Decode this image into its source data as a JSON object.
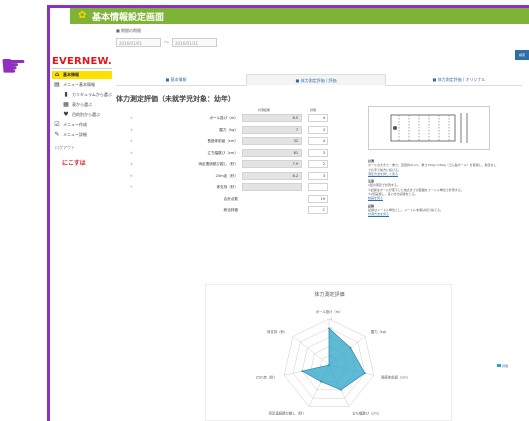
{
  "colors": {
    "accent_purple": "#8e2fbf",
    "title_green": "#7fb338",
    "active_yellow": "#ffe100",
    "brand_red": "#e3161b",
    "radar_fill": "#29a3c8",
    "link_blue": "#2f6fa8"
  },
  "header": {
    "icon": "gear-icon",
    "title": "基本情報設定画面"
  },
  "date_filter": {
    "label": "■ 期間の期間",
    "from": "2016/01/01",
    "separator": "～",
    "to": "2016/01/31"
  },
  "search_button": {
    "label": "検索"
  },
  "sidebar": {
    "logo": "EVERNEW.",
    "items": [
      {
        "label": "基本情報",
        "icon": "home-icon",
        "active": true,
        "sub": false
      },
      {
        "label": "メニュー基本情報",
        "icon": "menu-icon",
        "active": false,
        "sub": false
      },
      {
        "label": "カリキュラムから選ぶ",
        "icon": "file-icon",
        "active": false,
        "sub": true
      },
      {
        "label": "表から選ぶ",
        "icon": "grid-icon",
        "active": false,
        "sub": true
      },
      {
        "label": "目的別から選ぶ",
        "icon": "pin-icon",
        "active": false,
        "sub": true
      },
      {
        "label": "メニュー作成",
        "icon": "check-icon",
        "active": false,
        "sub": false
      },
      {
        "label": "メニュー詳細",
        "icon": "pencil-icon",
        "active": false,
        "sub": false
      }
    ],
    "logout": "ログアウト",
    "brand_mark": "にこすは"
  },
  "tabs": [
    {
      "label": "■ 基本情報",
      "active": false
    },
    {
      "label": "■ 体力測定評価 / 評価",
      "active": true
    },
    {
      "label": "■ 体力測定評価 / オリジナル",
      "active": false
    }
  ],
  "section": {
    "title": "体力測定評価（未就学児対象：幼年）",
    "col_result": "計測結果",
    "col_score": "評価"
  },
  "table": {
    "rows": [
      {
        "no": "①",
        "label": "ボール投げ（m）",
        "value": "8.5",
        "score": "4"
      },
      {
        "no": "②",
        "label": "握力（kg）",
        "value": "7",
        "score": "3"
      },
      {
        "no": "③",
        "label": "長座体前屈（cm）",
        "value": "32",
        "score": "4"
      },
      {
        "no": "④",
        "label": "立ち幅跳び（cm）",
        "value": "81",
        "score": "3"
      },
      {
        "no": "⑤",
        "label": "両足連続跳び越し（秒）",
        "value": "7.9",
        "score": "2"
      },
      {
        "no": "⑥",
        "label": "25m走（秒）",
        "value": "8.2",
        "score": "3"
      },
      {
        "no": "⑦",
        "label": "体支持（秒）",
        "value": "",
        "score": ""
      },
      {
        "no": "",
        "label": "合計点数",
        "value": "",
        "score": "19"
      },
      {
        "no": "",
        "label": "総合評価",
        "value": "",
        "score": "C"
      }
    ]
  },
  "notes": {
    "h1": "計測",
    "p1": "ボールの大きさ・重さ：直径約21cm、重さ150g〜180g（ゴム製ボール）を使用し、助走なしで片手で前方に投げる。",
    "link1": "測定方法を詳しく見る",
    "h2": "注意",
    "p2": "1回の測定で計測する。",
    "p3": "①記録はボールが落下した地点までの距離をメートル単位で計測する。",
    "p4": "②2回実施し、良い方の記録をとる。",
    "link2": "動画を見る",
    "h3": "記録",
    "p5": "記録はメートル単位とし、メートル未満は切り捨てる。",
    "link3": "計測方法を見る"
  },
  "chart_data": {
    "type": "radar",
    "title": "体力測定評価",
    "axes": [
      "ボール投げ（m）",
      "握力（kg）",
      "長座体前屈（cm）",
      "立ち幅跳び（cm）",
      "両足連続跳び越し（秒）",
      "25m走（秒）",
      "体支持（秒）"
    ],
    "range": [
      0,
      5
    ],
    "ticks": [
      1,
      2,
      3,
      4,
      5
    ],
    "series": [
      {
        "name": "評価",
        "values": [
          4,
          3,
          4,
          3,
          2,
          3,
          0
        ]
      }
    ]
  }
}
